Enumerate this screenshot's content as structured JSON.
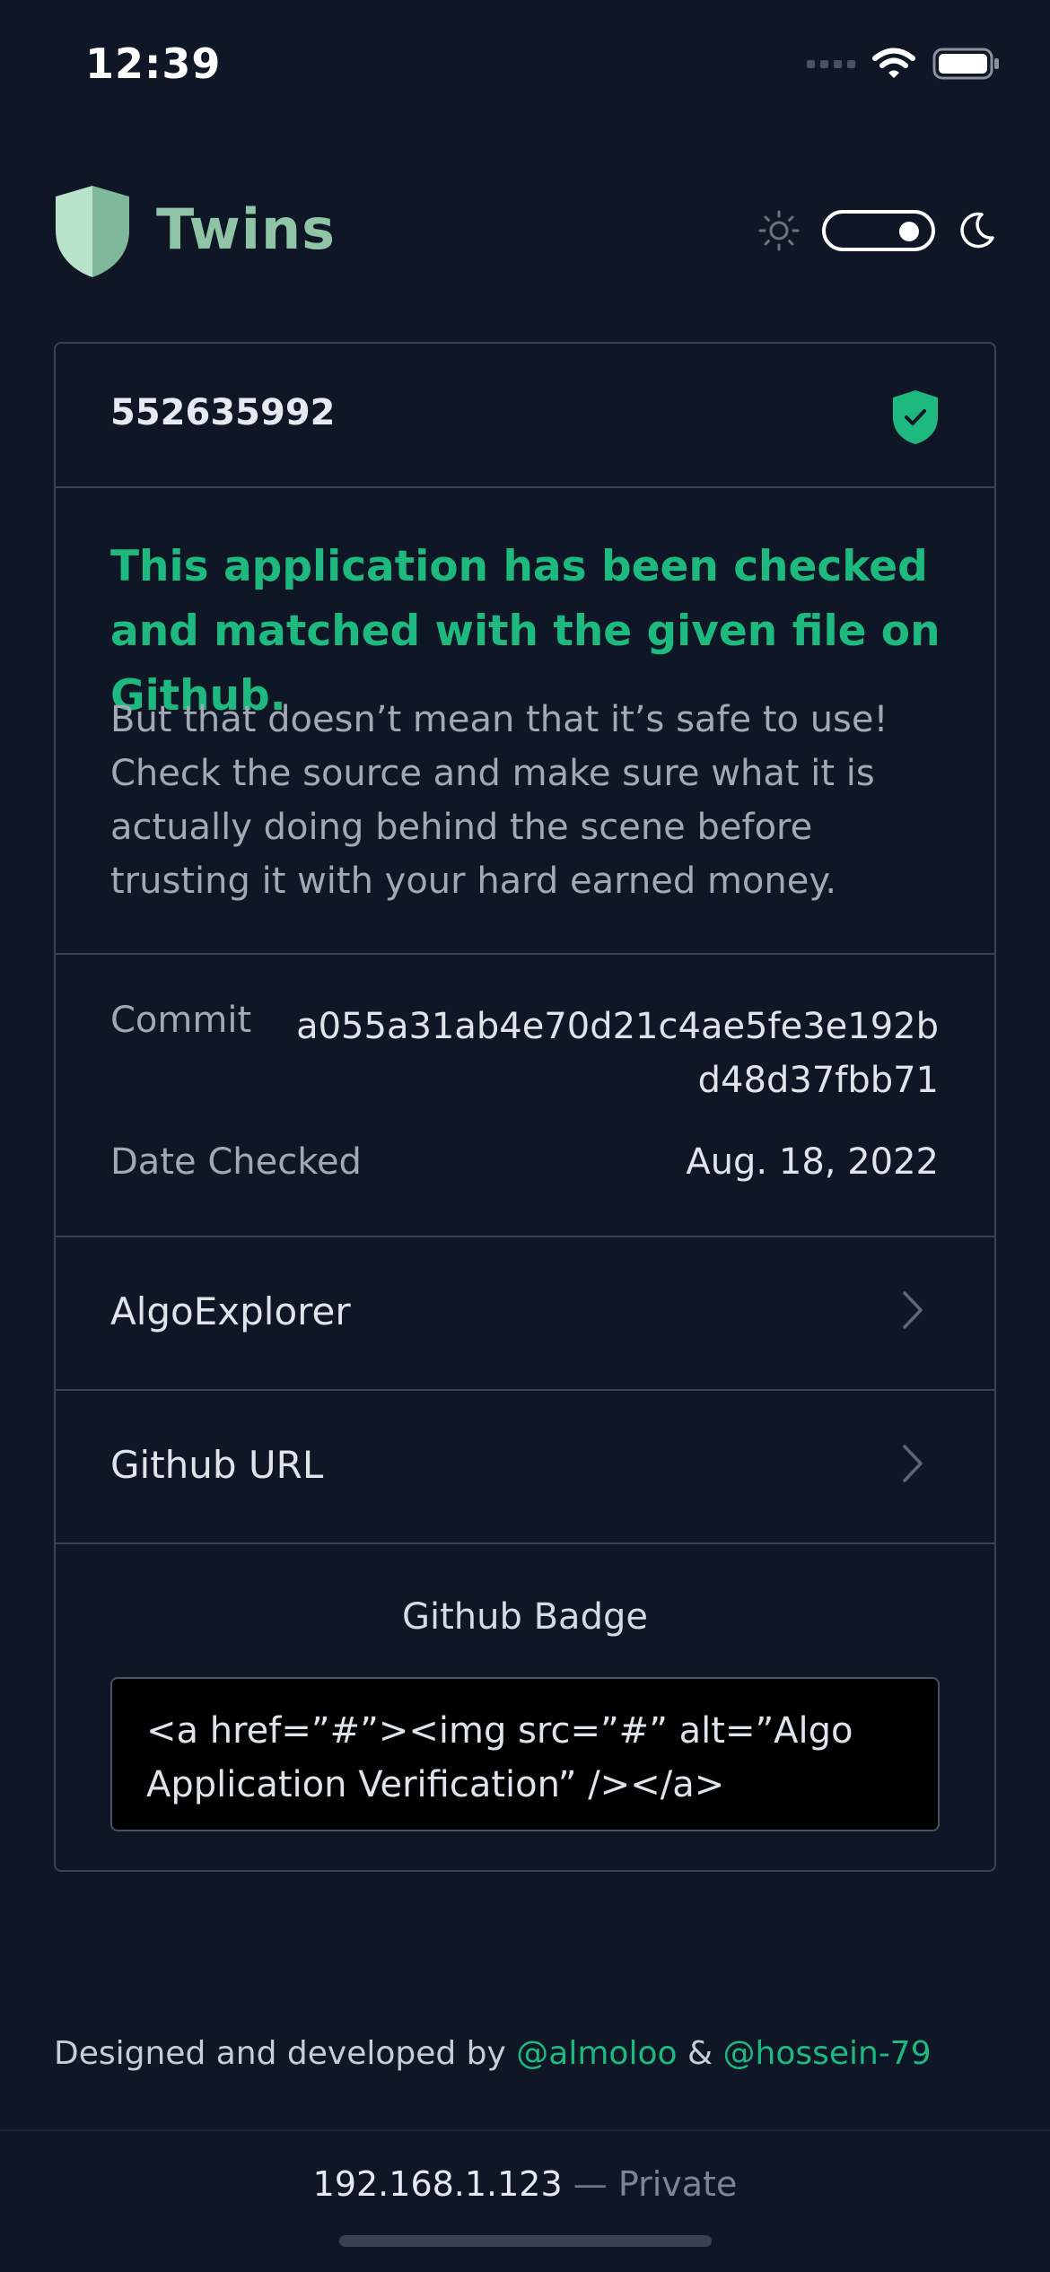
{
  "status_bar": {
    "time": "12:39"
  },
  "header": {
    "brand": "Twins",
    "theme": "dark"
  },
  "card": {
    "app_id": "552635992",
    "verified_title": "This application has been checked and matched with the given file on Github.",
    "disclaimer": "But that doesn’t mean that it’s safe to use! Check the source and make sure what it is actually doing behind the scene before trusting it with your hard earned money.",
    "meta": {
      "commit_label": "Commit",
      "commit_value": "a055a31ab4e70d21c4ae5fe3e192bd48d37fbb71",
      "date_label": "Date Checked",
      "date_value": "Aug. 18, 2022"
    },
    "links": [
      {
        "label": "AlgoExplorer"
      },
      {
        "label": "Github URL"
      }
    ],
    "badge": {
      "title": "Github Badge",
      "code": "<a href=”#”><img src=”#” alt=”Algo Application Verification” /></a>"
    }
  },
  "credits": {
    "prefix": "Designed and developed by",
    "author1": "@almoloo",
    "joiner": "&",
    "author2": "@hossein-79"
  },
  "footer": {
    "ip": "192.168.1.123",
    "separator": "—",
    "label": "Private"
  },
  "colors": {
    "accent": "#1db97f",
    "background": "#0f1626",
    "brand": "#8fc4a6"
  }
}
